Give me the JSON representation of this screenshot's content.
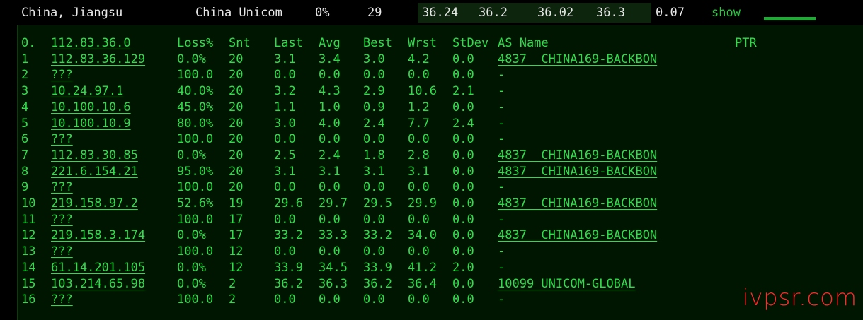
{
  "summary": {
    "location": "China, Jiangsu",
    "isp": "China Unicom",
    "loss": "0%",
    "sent": "29",
    "latencies": [
      "36.24",
      "36.2",
      "36.02",
      "36.3"
    ],
    "stdev": "0.07",
    "show_label": "show"
  },
  "mtr": {
    "headers": {
      "hop": "0.",
      "host": "112.83.36.0",
      "loss": "Loss%",
      "snt": "Snt",
      "last": "Last",
      "avg": "Avg",
      "best": "Best",
      "wrst": "Wrst",
      "stdev": "StDev",
      "as": "AS Name",
      "ptr": "PTR"
    },
    "rows": [
      {
        "hop": "1",
        "host": "112.83.36.129",
        "loss": "0.0%",
        "snt": "20",
        "last": "3.1",
        "avg": "3.4",
        "best": "3.0",
        "wrst": "4.2",
        "stdev": "0.0",
        "as": "4837  CHINA169-BACKBON"
      },
      {
        "hop": "2",
        "host": "???",
        "loss": "100.0",
        "snt": "20",
        "last": "0.0",
        "avg": "0.0",
        "best": "0.0",
        "wrst": "0.0",
        "stdev": "0.0",
        "as": "-"
      },
      {
        "hop": "3",
        "host": "10.24.97.1",
        "loss": "40.0%",
        "snt": "20",
        "last": "3.2",
        "avg": "4.3",
        "best": "2.9",
        "wrst": "10.6",
        "stdev": "2.1",
        "as": "-"
      },
      {
        "hop": "4",
        "host": "10.100.10.6",
        "loss": "45.0%",
        "snt": "20",
        "last": "1.1",
        "avg": "1.0",
        "best": "0.9",
        "wrst": "1.2",
        "stdev": "0.0",
        "as": "-"
      },
      {
        "hop": "5",
        "host": "10.100.10.9",
        "loss": "80.0%",
        "snt": "20",
        "last": "3.0",
        "avg": "4.0",
        "best": "2.4",
        "wrst": "7.7",
        "stdev": "2.4",
        "as": "-"
      },
      {
        "hop": "6",
        "host": "???",
        "loss": "100.0",
        "snt": "20",
        "last": "0.0",
        "avg": "0.0",
        "best": "0.0",
        "wrst": "0.0",
        "stdev": "0.0",
        "as": "-"
      },
      {
        "hop": "7",
        "host": "112.83.30.85",
        "loss": "0.0%",
        "snt": "20",
        "last": "2.5",
        "avg": "2.4",
        "best": "1.8",
        "wrst": "2.8",
        "stdev": "0.0",
        "as": "4837  CHINA169-BACKBON"
      },
      {
        "hop": "8",
        "host": "221.6.154.21",
        "loss": "95.0%",
        "snt": "20",
        "last": "3.1",
        "avg": "3.1",
        "best": "3.1",
        "wrst": "3.1",
        "stdev": "0.0",
        "as": "4837  CHINA169-BACKBON"
      },
      {
        "hop": "9",
        "host": "???",
        "loss": "100.0",
        "snt": "20",
        "last": "0.0",
        "avg": "0.0",
        "best": "0.0",
        "wrst": "0.0",
        "stdev": "0.0",
        "as": "-"
      },
      {
        "hop": "10",
        "host": "219.158.97.2",
        "loss": "52.6%",
        "snt": "19",
        "last": "29.6",
        "avg": "29.7",
        "best": "29.5",
        "wrst": "29.9",
        "stdev": "0.0",
        "as": "4837  CHINA169-BACKBON"
      },
      {
        "hop": "11",
        "host": "???",
        "loss": "100.0",
        "snt": "17",
        "last": "0.0",
        "avg": "0.0",
        "best": "0.0",
        "wrst": "0.0",
        "stdev": "0.0",
        "as": "-"
      },
      {
        "hop": "12",
        "host": "219.158.3.174",
        "loss": "0.0%",
        "snt": "17",
        "last": "33.2",
        "avg": "33.3",
        "best": "33.2",
        "wrst": "34.0",
        "stdev": "0.0",
        "as": "4837  CHINA169-BACKBON"
      },
      {
        "hop": "13",
        "host": "???",
        "loss": "100.0",
        "snt": "12",
        "last": "0.0",
        "avg": "0.0",
        "best": "0.0",
        "wrst": "0.0",
        "stdev": "0.0",
        "as": "-"
      },
      {
        "hop": "14",
        "host": "61.14.201.105",
        "loss": "0.0%",
        "snt": "12",
        "last": "33.9",
        "avg": "34.5",
        "best": "33.9",
        "wrst": "41.2",
        "stdev": "2.0",
        "as": "-"
      },
      {
        "hop": "15",
        "host": "103.214.65.98",
        "loss": "0.0%",
        "snt": "2",
        "last": "36.2",
        "avg": "36.3",
        "best": "36.2",
        "wrst": "36.4",
        "stdev": "0.0",
        "as": "10099 UNICOM-GLOBAL"
      },
      {
        "hop": "16",
        "host": "???",
        "loss": "100.0",
        "snt": "2",
        "last": "0.0",
        "avg": "0.0",
        "best": "0.0",
        "wrst": "0.0",
        "stdev": "0.0",
        "as": "-"
      }
    ]
  },
  "watermark": "ivpsr.com",
  "colors": {
    "text_green": "#2fdc4a",
    "panel_bg": "#001600",
    "show_link": "#27c93f",
    "watermark": "#ff2a2a"
  }
}
